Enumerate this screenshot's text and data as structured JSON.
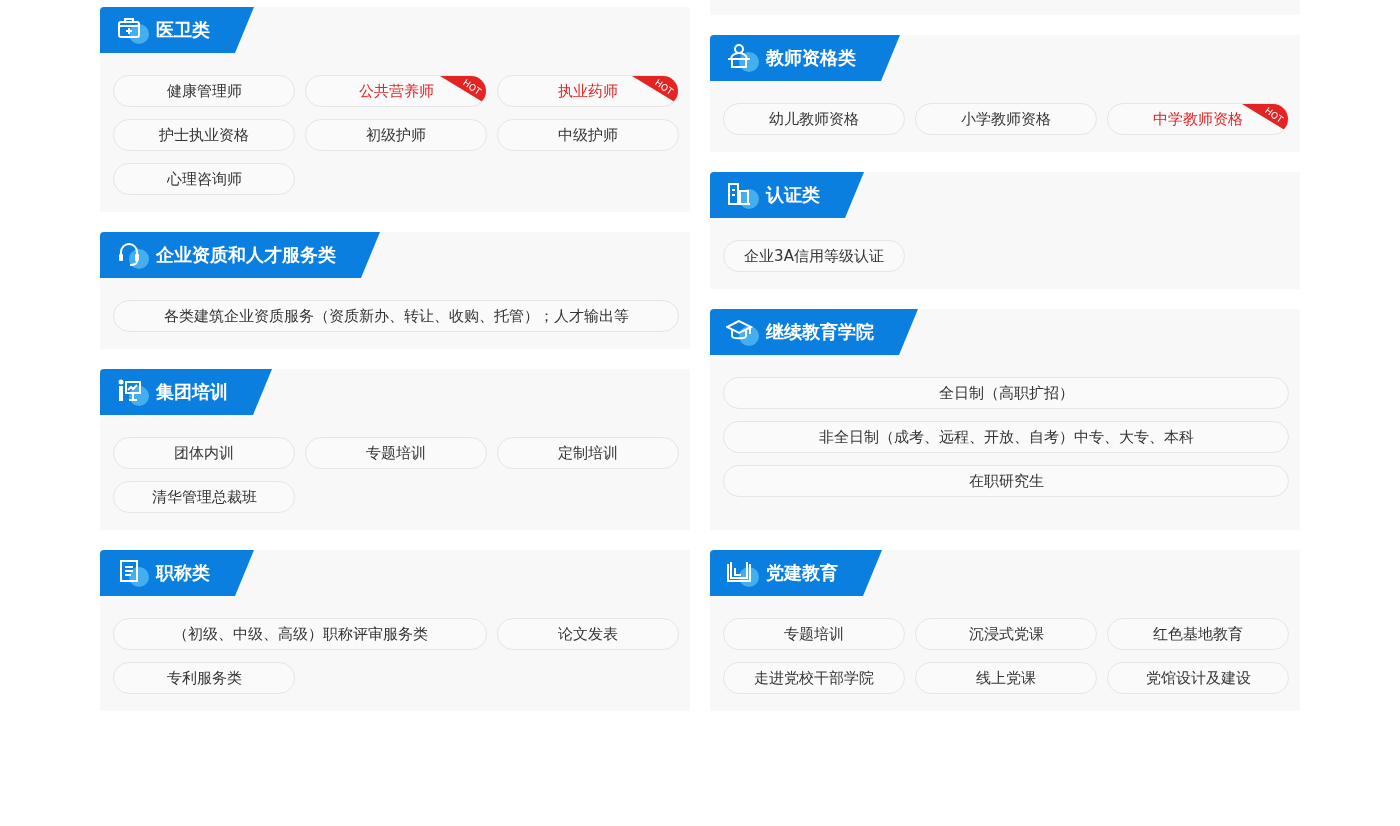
{
  "columns": [
    {
      "cards": [
        {
          "title": "医卫类",
          "kind": "grid",
          "items": [
            {
              "label": "健康管理师"
            },
            {
              "label": "公共营养师",
              "badge": "HOT"
            },
            {
              "label": "执业药师",
              "badge": "HOT"
            },
            {
              "label": "护士执业资格"
            },
            {
              "label": "初级护师"
            },
            {
              "label": "中级护师"
            },
            {
              "label": "心理咨询师"
            }
          ]
        },
        {
          "title": "企业资质和人才服务类",
          "kind": "grid",
          "items": [
            {
              "label": "各类建筑企业资质服务（资质新办、转让、收购、托管）；人才输出等"
            }
          ]
        },
        {
          "title": "集团培训",
          "kind": "grid",
          "items": [
            {
              "label": "团体内训"
            },
            {
              "label": "专题培训"
            },
            {
              "label": "定制培训"
            },
            {
              "label": "清华管理总裁班"
            }
          ]
        }
      ]
    },
    {
      "cards": [
        {
          "title": "教师资格类",
          "kind": "grid",
          "items": [
            {
              "label": "幼儿教师资格"
            },
            {
              "label": "小学教师资格"
            },
            {
              "label": "中学教师资格",
              "badge": "HOT"
            }
          ]
        },
        {
          "title": "认证类",
          "kind": "grid",
          "items": [
            {
              "label": "企业3A信用等级认证"
            }
          ]
        },
        {
          "title": "继续教育学院",
          "kind": "list",
          "items": [
            {
              "label": "全日制（高职扩招）"
            },
            {
              "label": "非全日制（成考、远程、开放、自考）中专、大专、本科"
            },
            {
              "label": "在职研究生"
            }
          ]
        }
      ]
    }
  ],
  "bottom": [
    {
      "title": "职称类",
      "kind": "grid",
      "items": [
        {
          "label": "（初级、中级、高级）职称评审服务类"
        },
        {
          "label": "论文发表"
        },
        {
          "label": "专利服务类"
        }
      ]
    },
    {
      "title": "党建教育",
      "kind": "grid",
      "items": [
        {
          "label": "专题培训"
        },
        {
          "label": "沉浸式党课"
        },
        {
          "label": "红色基地教育"
        },
        {
          "label": "走进党校干部学院"
        },
        {
          "label": "线上党课"
        },
        {
          "label": "党馆设计及建设"
        }
      ]
    }
  ]
}
